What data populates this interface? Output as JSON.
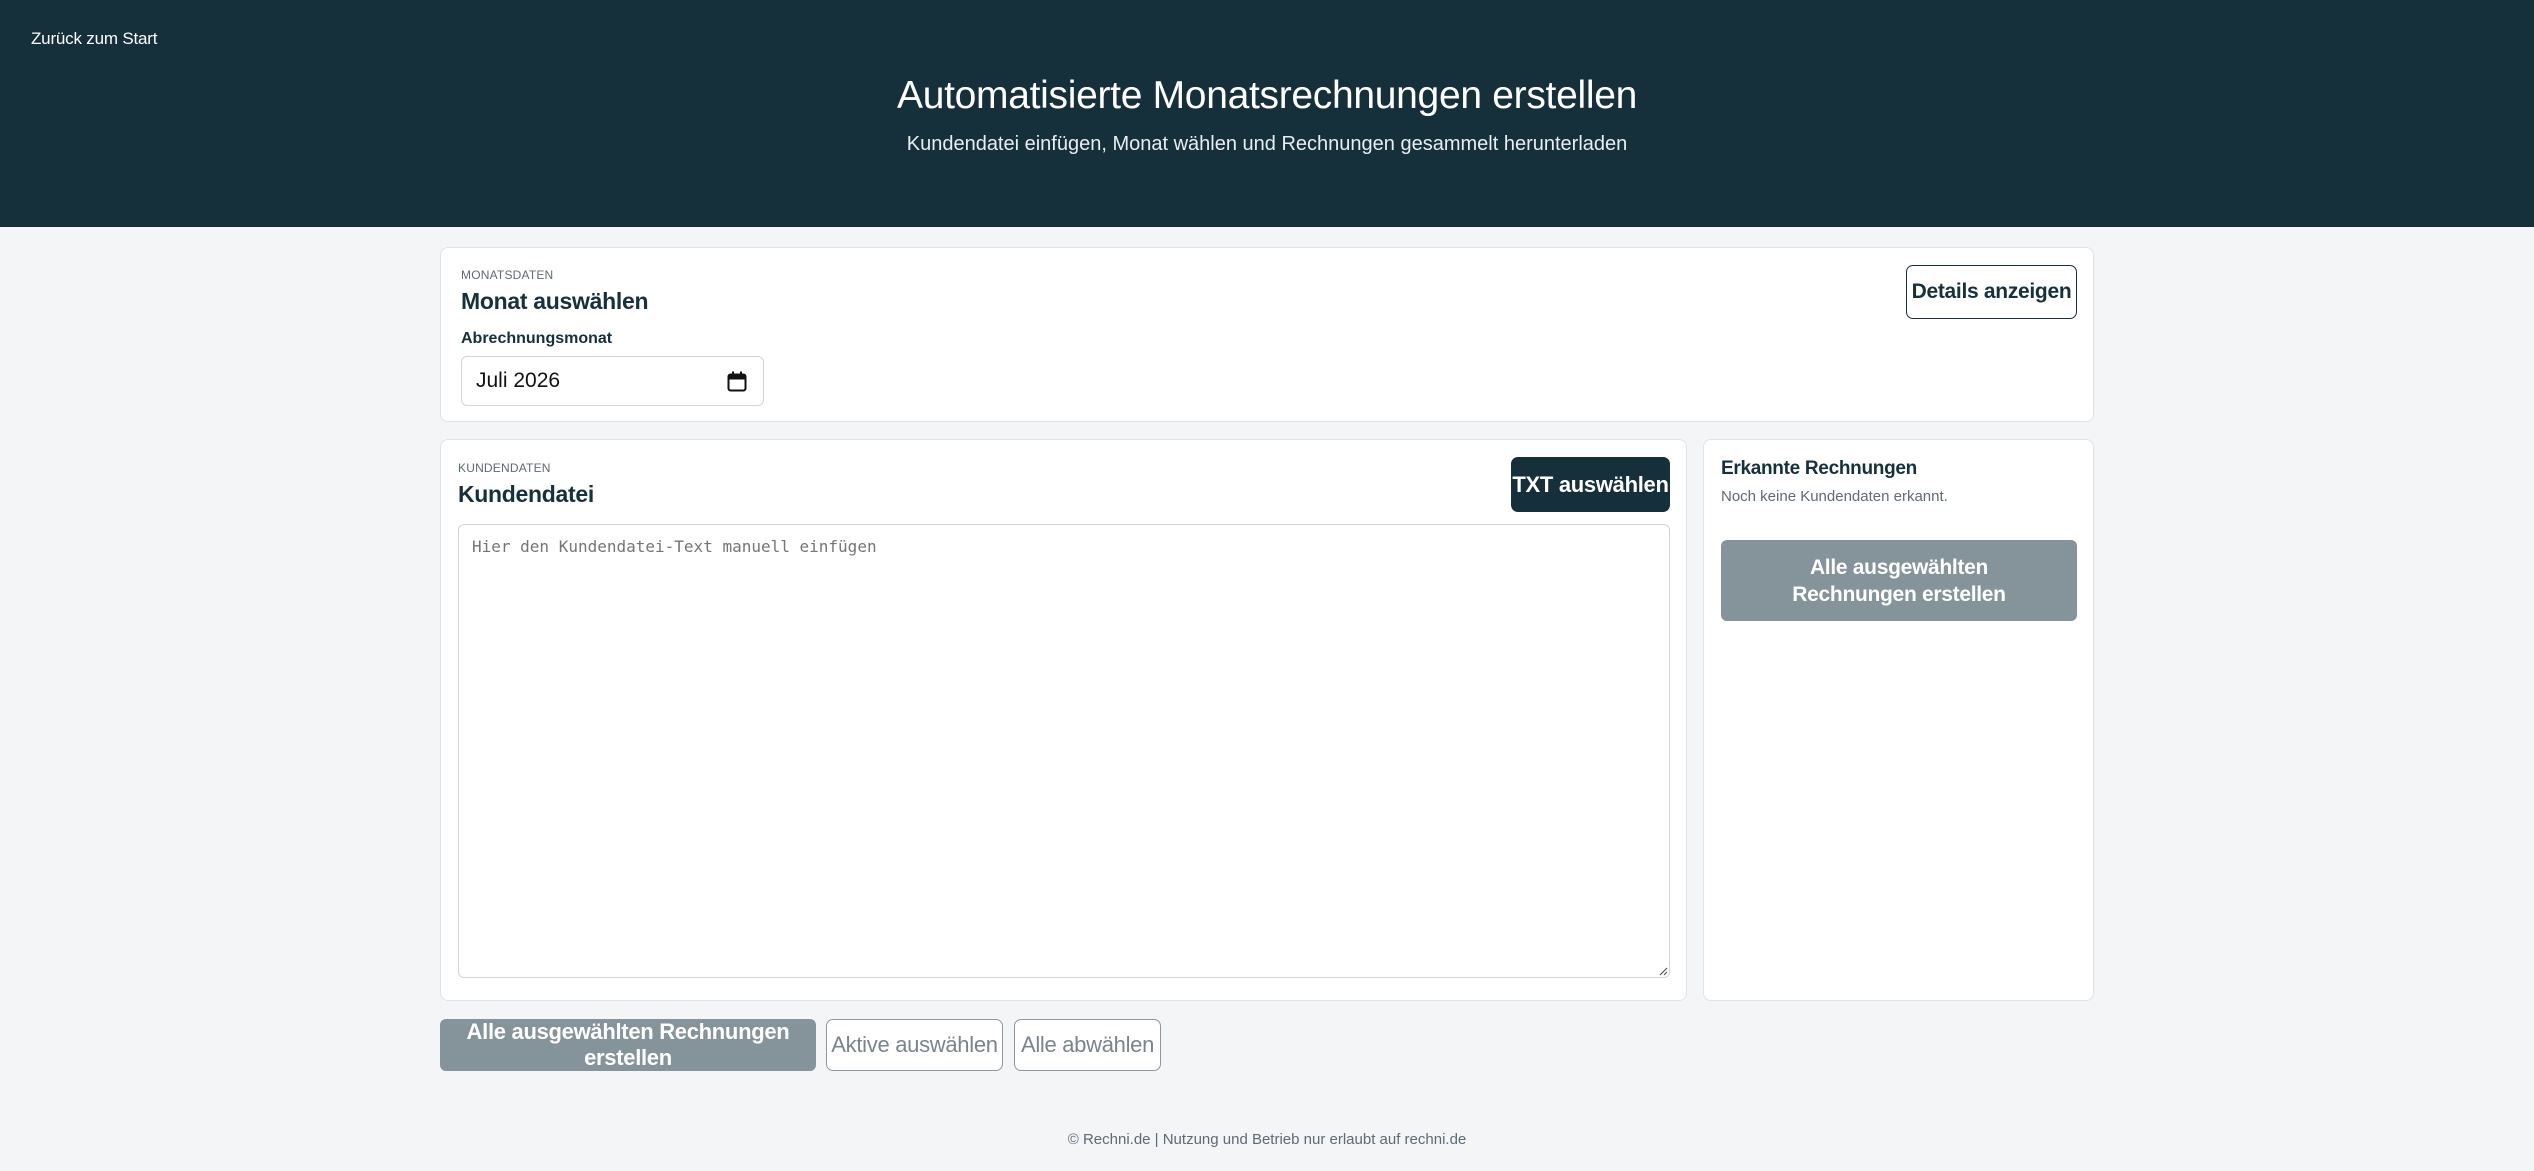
{
  "nav": {
    "back_label": "Zurück zum Start"
  },
  "header": {
    "title": "Automatisierte Monatsrechnungen erstellen",
    "subtitle": "Kundendatei einfügen, Monat wählen und Rechnungen gesammelt herunterladen"
  },
  "month_card": {
    "eyebrow": "MONATSDATEN",
    "title": "Monat auswählen",
    "details_button": "Details anzeigen",
    "field_label": "Abrechnungsmonat",
    "month_value": "Juli 2026",
    "calendar_icon": "calendar-icon"
  },
  "customer_card": {
    "eyebrow": "KUNDENDATEN",
    "title": "Kundendatei",
    "txt_button": "TXT auswählen",
    "textarea_placeholder": "Hier den Kundendatei-Text manuell einfügen",
    "textarea_value": ""
  },
  "invoices_card": {
    "title": "Erkannte Rechnungen",
    "empty_text": "Noch keine Kundendaten erkannt.",
    "create_all_button": "Alle ausgewählten Rechnungen erstellen"
  },
  "actions": {
    "create_all_button": "Alle ausgewählten Rechnungen erstellen",
    "select_active_button": "Aktive auswählen",
    "deselect_all_button": "Alle abwählen"
  },
  "footer": {
    "text": "© Rechni.de | Nutzung und Betrieb nur erlaubt auf rechni.de"
  },
  "colors": {
    "header_bg": "#152f3b",
    "page_bg": "#f3f5f7",
    "primary": "#152f3b",
    "disabled": "#85939a"
  }
}
